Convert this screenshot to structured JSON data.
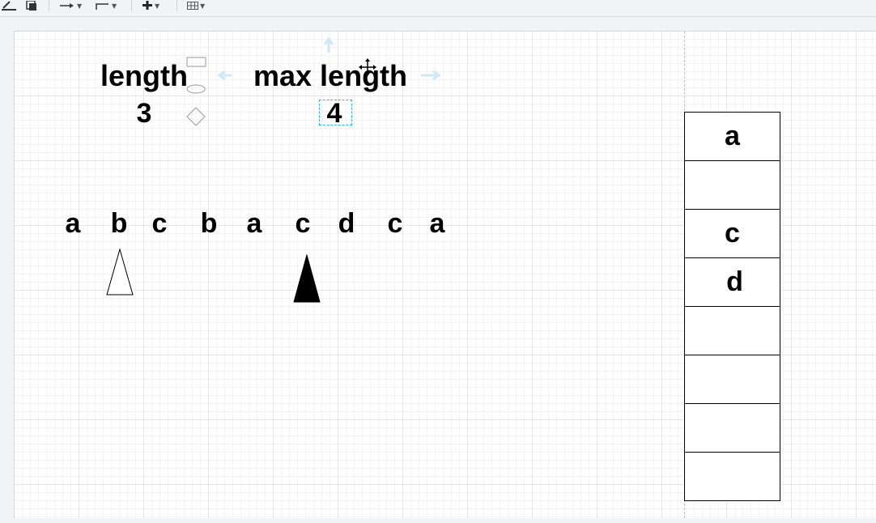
{
  "toolbar": {
    "icons": [
      "line-color-icon",
      "shadow-icon",
      "connection-arrow-icon",
      "waypoint-style-icon",
      "insert-plus-icon",
      "table-icon"
    ]
  },
  "labels": {
    "length_label": "length",
    "length_value": "3",
    "max_length_label": "max length",
    "max_length_value": "4"
  },
  "sequence": [
    "a",
    "b",
    "c",
    "b",
    "a",
    "c",
    "d",
    "c",
    "a"
  ],
  "pointers": [
    {
      "name": "left-pointer",
      "style": "outline",
      "at_index": 1
    },
    {
      "name": "right-pointer",
      "style": "filled",
      "at_index": 5
    }
  ],
  "stack": [
    "a",
    "",
    "c",
    "d",
    "",
    "",
    "",
    ""
  ],
  "colors": {
    "selection": "#29b6f2",
    "hint_arrow": "#cfe8f7",
    "grid": "#e6e6e6"
  }
}
